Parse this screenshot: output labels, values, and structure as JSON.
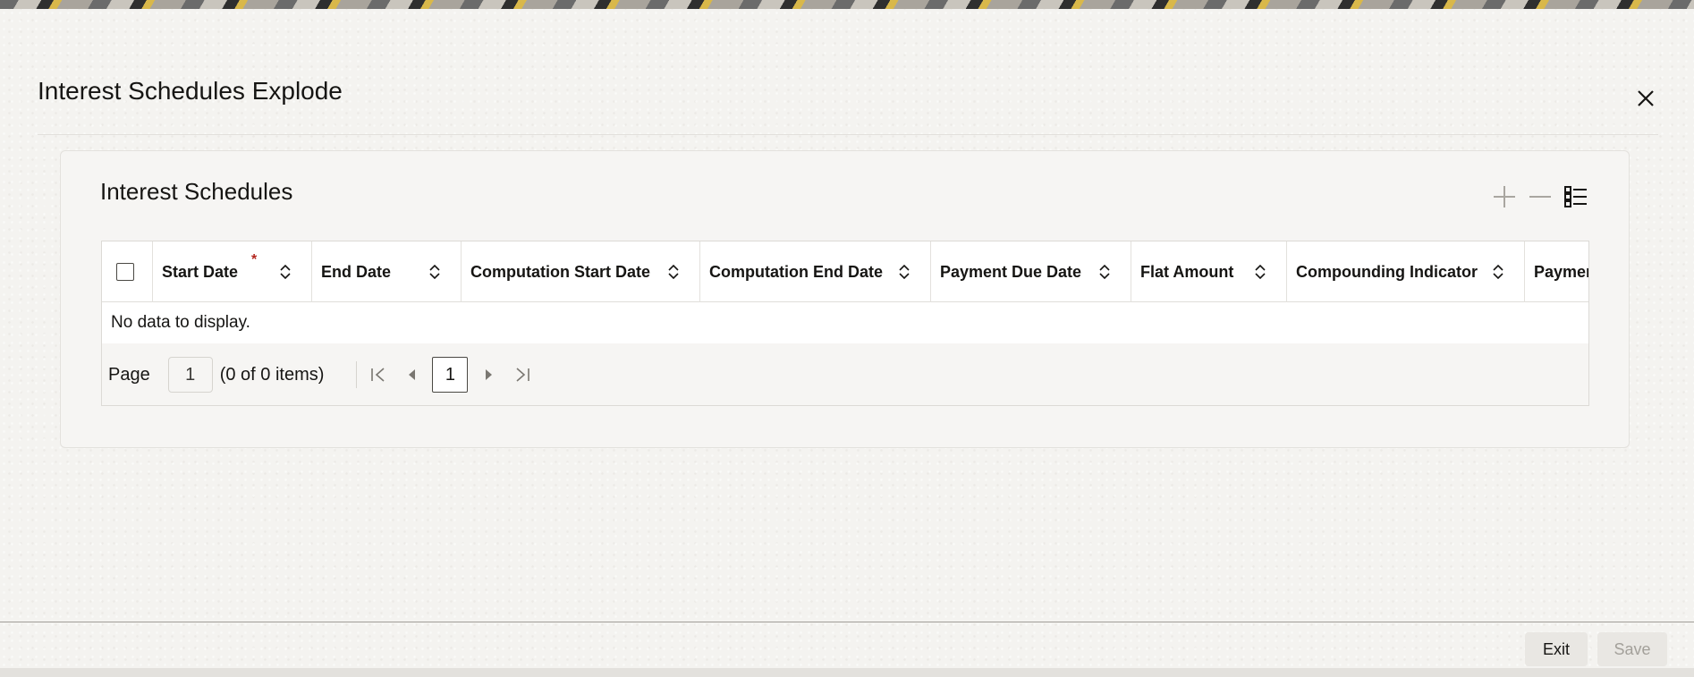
{
  "dialog": {
    "title": "Interest Schedules Explode",
    "close_icon": "close-icon"
  },
  "panel": {
    "title": "Interest Schedules",
    "toolbar": {
      "add_icon": "plus-icon",
      "remove_icon": "minus-icon",
      "columns_icon": "list-view-icon"
    }
  },
  "grid": {
    "required_marker": "*",
    "columns": [
      "Start Date",
      "End Date",
      "Computation Start Date",
      "Computation End Date",
      "Payment Due Date",
      "Flat Amount",
      "Compounding Indicator",
      "Paymen"
    ],
    "empty_message": "No data to display."
  },
  "pager": {
    "page_label": "Page",
    "page_value": "1",
    "count_text": "(0 of 0 items)",
    "current_page": "1"
  },
  "footer": {
    "exit_label": "Exit",
    "save_label": "Save"
  },
  "colors": {
    "required": "#b3261e",
    "text": "#161513",
    "disabled_text": "#a3a09a"
  }
}
